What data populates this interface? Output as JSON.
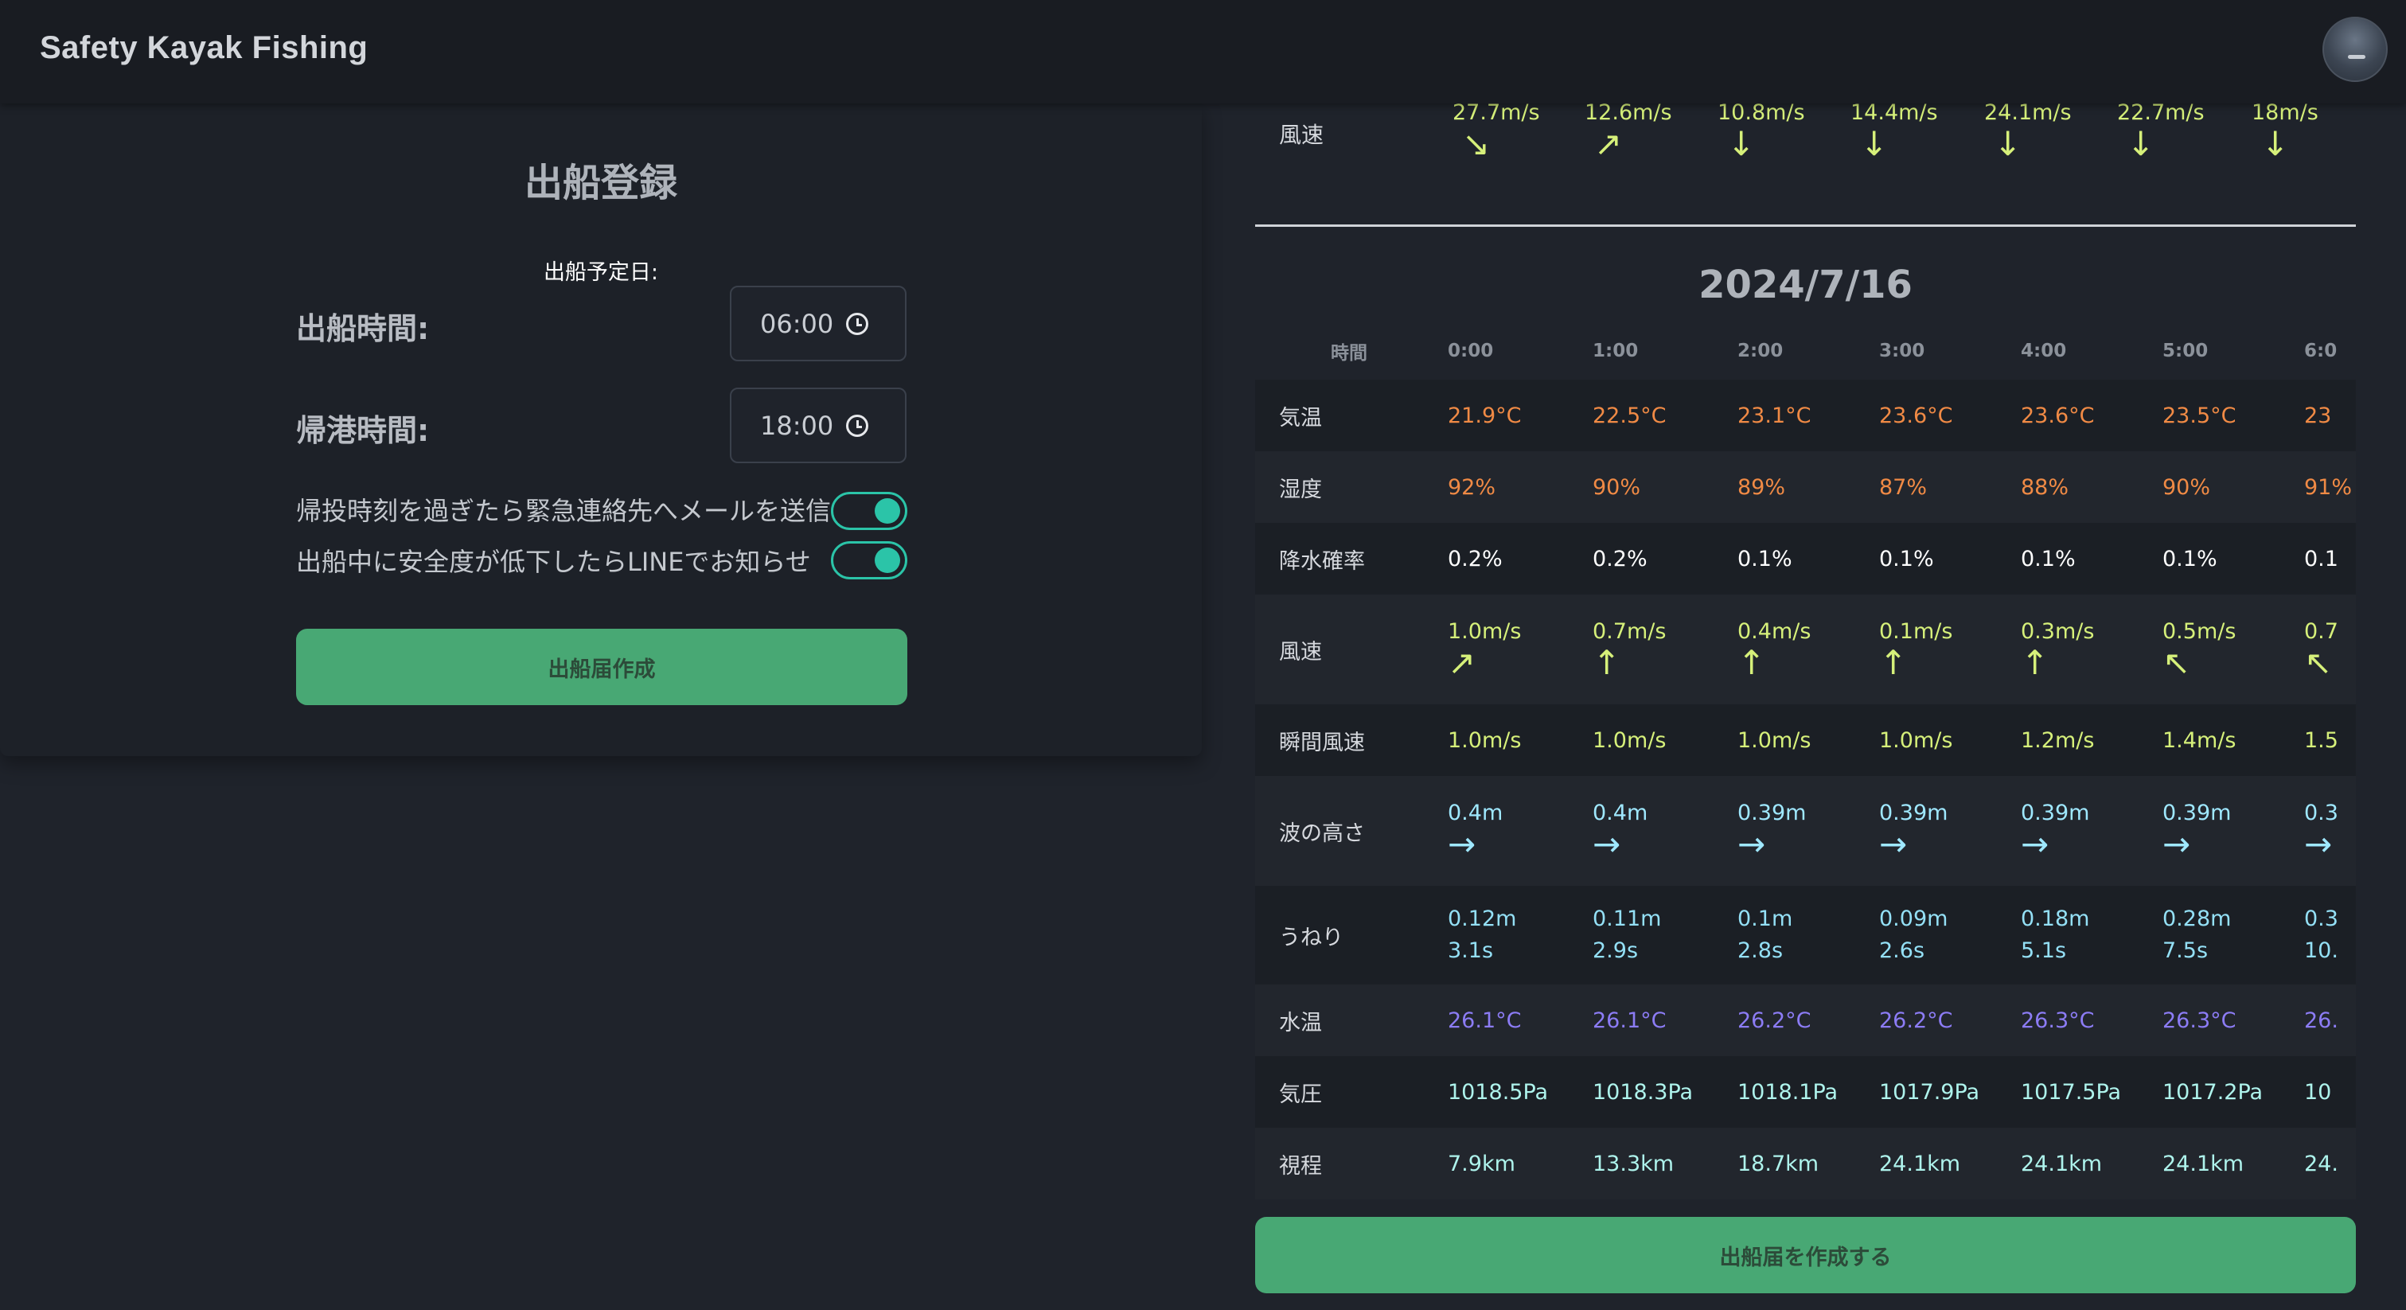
{
  "header": {
    "brand": "Safety Kayak Fishing"
  },
  "form": {
    "title": "出船登録",
    "date_label": "出船予定日:",
    "depart_label": "出船時間:",
    "depart_value": "06:00",
    "return_label": "帰港時間:",
    "return_value": "18:00",
    "toggle_email_label": "帰投時刻を過ぎたら緊急連絡先へメールを送信",
    "toggle_email_on": true,
    "toggle_line_label": "出船中に安全度が低下したらLINEでお知らせ",
    "toggle_line_on": true,
    "create_button": "出船届作成"
  },
  "forecast": {
    "prev_day": {
      "wind_label": "風速",
      "wind": [
        {
          "speed": "27.7m/s",
          "arrow": "↘"
        },
        {
          "speed": "12.6m/s",
          "arrow": "↗"
        },
        {
          "speed": "10.8m/s",
          "arrow": "↓"
        },
        {
          "speed": "14.4m/s",
          "arrow": "↓"
        },
        {
          "speed": "24.1m/s",
          "arrow": "↓"
        },
        {
          "speed": "22.7m/s",
          "arrow": "↓"
        },
        {
          "speed": "18m/s",
          "arrow": "↓"
        }
      ]
    },
    "date": "2024/7/16",
    "time_header": "時間",
    "hours": [
      "0:00",
      "1:00",
      "2:00",
      "3:00",
      "4:00",
      "5:00",
      "6:0"
    ],
    "rows": {
      "temp": {
        "label": "気温",
        "values": [
          "21.9°C",
          "22.5°C",
          "23.1°C",
          "23.6°C",
          "23.6°C",
          "23.5°C",
          "23"
        ]
      },
      "humidity": {
        "label": "湿度",
        "values": [
          "92%",
          "90%",
          "89%",
          "87%",
          "88%",
          "90%",
          "91%"
        ]
      },
      "precip": {
        "label": "降水確率",
        "values": [
          "0.2%",
          "0.2%",
          "0.1%",
          "0.1%",
          "0.1%",
          "0.1%",
          "0.1"
        ]
      },
      "wind": {
        "label": "風速",
        "values": [
          {
            "speed": "1.0m/s",
            "arrow": "↗"
          },
          {
            "speed": "0.7m/s",
            "arrow": "↑"
          },
          {
            "speed": "0.4m/s",
            "arrow": "↑"
          },
          {
            "speed": "0.1m/s",
            "arrow": "↑"
          },
          {
            "speed": "0.3m/s",
            "arrow": "↑"
          },
          {
            "speed": "0.5m/s",
            "arrow": "↖"
          },
          {
            "speed": "0.7",
            "arrow": "↖"
          }
        ]
      },
      "gust": {
        "label": "瞬間風速",
        "values": [
          "1.0m/s",
          "1.0m/s",
          "1.0m/s",
          "1.0m/s",
          "1.2m/s",
          "1.4m/s",
          "1.5"
        ]
      },
      "wave": {
        "label": "波の高さ",
        "values": [
          {
            "height": "0.4m",
            "arrow": "→"
          },
          {
            "height": "0.4m",
            "arrow": "→"
          },
          {
            "height": "0.39m",
            "arrow": "→"
          },
          {
            "height": "0.39m",
            "arrow": "→"
          },
          {
            "height": "0.39m",
            "arrow": "→"
          },
          {
            "height": "0.39m",
            "arrow": "→"
          },
          {
            "height": "0.3",
            "arrow": "→"
          }
        ]
      },
      "swell": {
        "label": "うねり",
        "values": [
          {
            "height": "0.12m",
            "period": "3.1s"
          },
          {
            "height": "0.11m",
            "period": "2.9s"
          },
          {
            "height": "0.1m",
            "period": "2.8s"
          },
          {
            "height": "0.09m",
            "period": "2.6s"
          },
          {
            "height": "0.18m",
            "period": "5.1s"
          },
          {
            "height": "0.28m",
            "period": "7.5s"
          },
          {
            "height": "0.3",
            "period": "10."
          }
        ]
      },
      "water_temp": {
        "label": "水温",
        "values": [
          "26.1°C",
          "26.1°C",
          "26.2°C",
          "26.2°C",
          "26.3°C",
          "26.3°C",
          "26."
        ]
      },
      "pressure": {
        "label": "気圧",
        "values": [
          "1018.5Pa",
          "1018.3Pa",
          "1018.1Pa",
          "1017.9Pa",
          "1017.5Pa",
          "1017.2Pa",
          "10"
        ]
      },
      "visibility": {
        "label": "視程",
        "values": [
          "7.9km",
          "13.3km",
          "18.7km",
          "24.1km",
          "24.1km",
          "24.1km",
          "24."
        ]
      }
    },
    "submit_button": "出船届を作成する"
  }
}
